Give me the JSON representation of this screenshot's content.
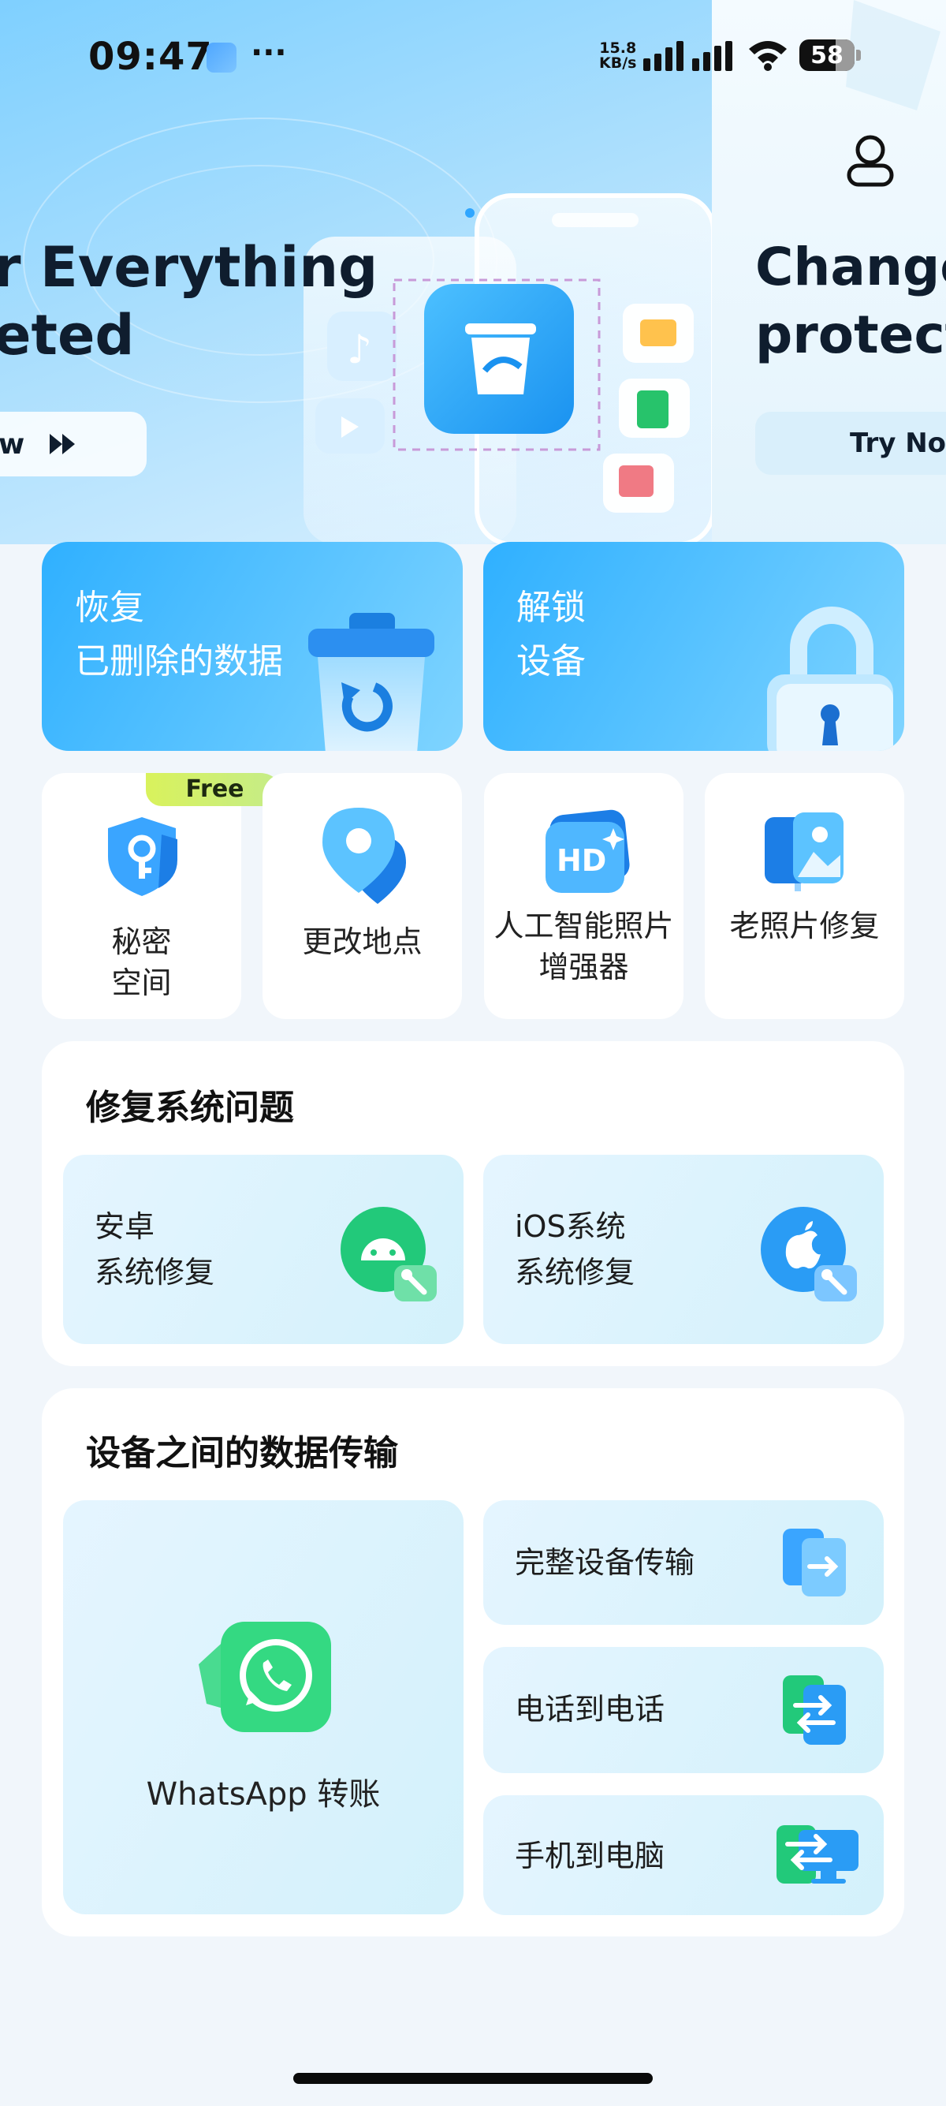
{
  "status_bar": {
    "time": "09:47",
    "more": "···",
    "network_speed_value": "15.8",
    "network_speed_unit": "KB/s",
    "battery": "58"
  },
  "banner": {
    "current": {
      "title_line1": "r Everything",
      "title_line2": "eted",
      "button_label": "w",
      "button_icon": "double-chevron-right-icon"
    },
    "next": {
      "title_line1": "Change",
      "title_line2": "protect",
      "button_label": "Try Now"
    },
    "profile_icon": "user-icon"
  },
  "features": {
    "recover": {
      "label": "恢复\n已删除的数据",
      "icon": "trash-restore-icon"
    },
    "unlock": {
      "label": "解锁\n设备",
      "icon": "padlock-icon"
    }
  },
  "tools": [
    {
      "label": "秘密\n空间",
      "icon": "shield-key-icon",
      "badge": "Free"
    },
    {
      "label": "更改地点",
      "icon": "location-pin-icon"
    },
    {
      "label": "人工智能照片\n增强器",
      "icon": "hd-photo-icon"
    },
    {
      "label": "老照片修复",
      "icon": "photo-restore-icon"
    }
  ],
  "repair": {
    "title": "修复系统问题",
    "items": [
      {
        "label": "安卓\n系统修复",
        "icon": "android-repair-icon"
      },
      {
        "label": "iOS系统\n系统修复",
        "icon": "apple-repair-icon"
      }
    ]
  },
  "transfer": {
    "title": "设备之间的数据传输",
    "whatsapp": {
      "label": "WhatsApp 转账",
      "icon": "whatsapp-icon"
    },
    "items": [
      {
        "label": "完整设备传输",
        "icon": "device-transfer-icon"
      },
      {
        "label": "电话到电话",
        "icon": "phone-to-phone-icon"
      },
      {
        "label": "手机到电脑",
        "icon": "phone-to-pc-icon"
      }
    ]
  },
  "colors": {
    "accent": "#2fb0ff",
    "background": "#f1f6fb",
    "whatsapp_green": "#2fd67c",
    "badge_yellow": "#d9f25c"
  }
}
